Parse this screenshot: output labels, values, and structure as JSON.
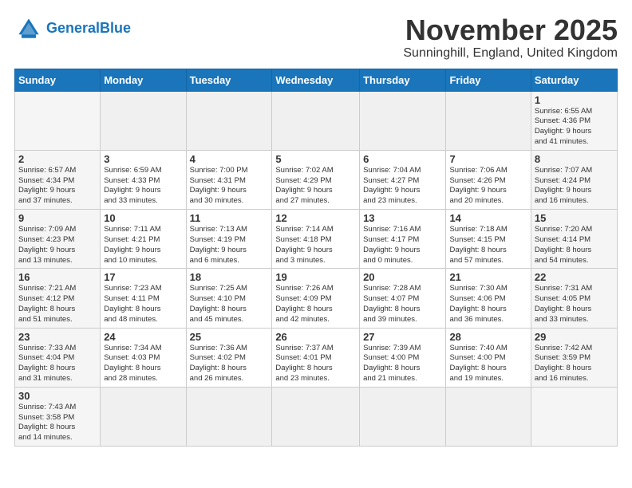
{
  "header": {
    "logo_general": "General",
    "logo_blue": "Blue",
    "month_title": "November 2025",
    "location": "Sunninghill, England, United Kingdom"
  },
  "weekdays": [
    "Sunday",
    "Monday",
    "Tuesday",
    "Wednesday",
    "Thursday",
    "Friday",
    "Saturday"
  ],
  "weeks": [
    [
      {
        "day": "",
        "info": ""
      },
      {
        "day": "",
        "info": ""
      },
      {
        "day": "",
        "info": ""
      },
      {
        "day": "",
        "info": ""
      },
      {
        "day": "",
        "info": ""
      },
      {
        "day": "",
        "info": ""
      },
      {
        "day": "1",
        "info": "Sunrise: 6:55 AM\nSunset: 4:36 PM\nDaylight: 9 hours\nand 41 minutes."
      }
    ],
    [
      {
        "day": "2",
        "info": "Sunrise: 6:57 AM\nSunset: 4:34 PM\nDaylight: 9 hours\nand 37 minutes."
      },
      {
        "day": "3",
        "info": "Sunrise: 6:59 AM\nSunset: 4:33 PM\nDaylight: 9 hours\nand 33 minutes."
      },
      {
        "day": "4",
        "info": "Sunrise: 7:00 PM\nSunset: 4:31 PM\nDaylight: 9 hours\nand 30 minutes."
      },
      {
        "day": "5",
        "info": "Sunrise: 7:02 AM\nSunset: 4:29 PM\nDaylight: 9 hours\nand 27 minutes."
      },
      {
        "day": "6",
        "info": "Sunrise: 7:04 AM\nSunset: 4:27 PM\nDaylight: 9 hours\nand 23 minutes."
      },
      {
        "day": "7",
        "info": "Sunrise: 7:06 AM\nSunset: 4:26 PM\nDaylight: 9 hours\nand 20 minutes."
      },
      {
        "day": "8",
        "info": "Sunrise: 7:07 AM\nSunset: 4:24 PM\nDaylight: 9 hours\nand 16 minutes."
      }
    ],
    [
      {
        "day": "9",
        "info": "Sunrise: 7:09 AM\nSunset: 4:23 PM\nDaylight: 9 hours\nand 13 minutes."
      },
      {
        "day": "10",
        "info": "Sunrise: 7:11 AM\nSunset: 4:21 PM\nDaylight: 9 hours\nand 10 minutes."
      },
      {
        "day": "11",
        "info": "Sunrise: 7:13 AM\nSunset: 4:19 PM\nDaylight: 9 hours\nand 6 minutes."
      },
      {
        "day": "12",
        "info": "Sunrise: 7:14 AM\nSunset: 4:18 PM\nDaylight: 9 hours\nand 3 minutes."
      },
      {
        "day": "13",
        "info": "Sunrise: 7:16 AM\nSunset: 4:17 PM\nDaylight: 9 hours\nand 0 minutes."
      },
      {
        "day": "14",
        "info": "Sunrise: 7:18 AM\nSunset: 4:15 PM\nDaylight: 8 hours\nand 57 minutes."
      },
      {
        "day": "15",
        "info": "Sunrise: 7:20 AM\nSunset: 4:14 PM\nDaylight: 8 hours\nand 54 minutes."
      }
    ],
    [
      {
        "day": "16",
        "info": "Sunrise: 7:21 AM\nSunset: 4:12 PM\nDaylight: 8 hours\nand 51 minutes."
      },
      {
        "day": "17",
        "info": "Sunrise: 7:23 AM\nSunset: 4:11 PM\nDaylight: 8 hours\nand 48 minutes."
      },
      {
        "day": "18",
        "info": "Sunrise: 7:25 AM\nSunset: 4:10 PM\nDaylight: 8 hours\nand 45 minutes."
      },
      {
        "day": "19",
        "info": "Sunrise: 7:26 AM\nSunset: 4:09 PM\nDaylight: 8 hours\nand 42 minutes."
      },
      {
        "day": "20",
        "info": "Sunrise: 7:28 AM\nSunset: 4:07 PM\nDaylight: 8 hours\nand 39 minutes."
      },
      {
        "day": "21",
        "info": "Sunrise: 7:30 AM\nSunset: 4:06 PM\nDaylight: 8 hours\nand 36 minutes."
      },
      {
        "day": "22",
        "info": "Sunrise: 7:31 AM\nSunset: 4:05 PM\nDaylight: 8 hours\nand 33 minutes."
      }
    ],
    [
      {
        "day": "23",
        "info": "Sunrise: 7:33 AM\nSunset: 4:04 PM\nDaylight: 8 hours\nand 31 minutes."
      },
      {
        "day": "24",
        "info": "Sunrise: 7:34 AM\nSunset: 4:03 PM\nDaylight: 8 hours\nand 28 minutes."
      },
      {
        "day": "25",
        "info": "Sunrise: 7:36 AM\nSunset: 4:02 PM\nDaylight: 8 hours\nand 26 minutes."
      },
      {
        "day": "26",
        "info": "Sunrise: 7:37 AM\nSunset: 4:01 PM\nDaylight: 8 hours\nand 23 minutes."
      },
      {
        "day": "27",
        "info": "Sunrise: 7:39 AM\nSunset: 4:00 PM\nDaylight: 8 hours\nand 21 minutes."
      },
      {
        "day": "28",
        "info": "Sunrise: 7:40 AM\nSunset: 4:00 PM\nDaylight: 8 hours\nand 19 minutes."
      },
      {
        "day": "29",
        "info": "Sunrise: 7:42 AM\nSunset: 3:59 PM\nDaylight: 8 hours\nand 16 minutes."
      }
    ],
    [
      {
        "day": "30",
        "info": "Sunrise: 7:43 AM\nSunset: 3:58 PM\nDaylight: 8 hours\nand 14 minutes."
      },
      {
        "day": "",
        "info": ""
      },
      {
        "day": "",
        "info": ""
      },
      {
        "day": "",
        "info": ""
      },
      {
        "day": "",
        "info": ""
      },
      {
        "day": "",
        "info": ""
      },
      {
        "day": "",
        "info": ""
      }
    ]
  ]
}
